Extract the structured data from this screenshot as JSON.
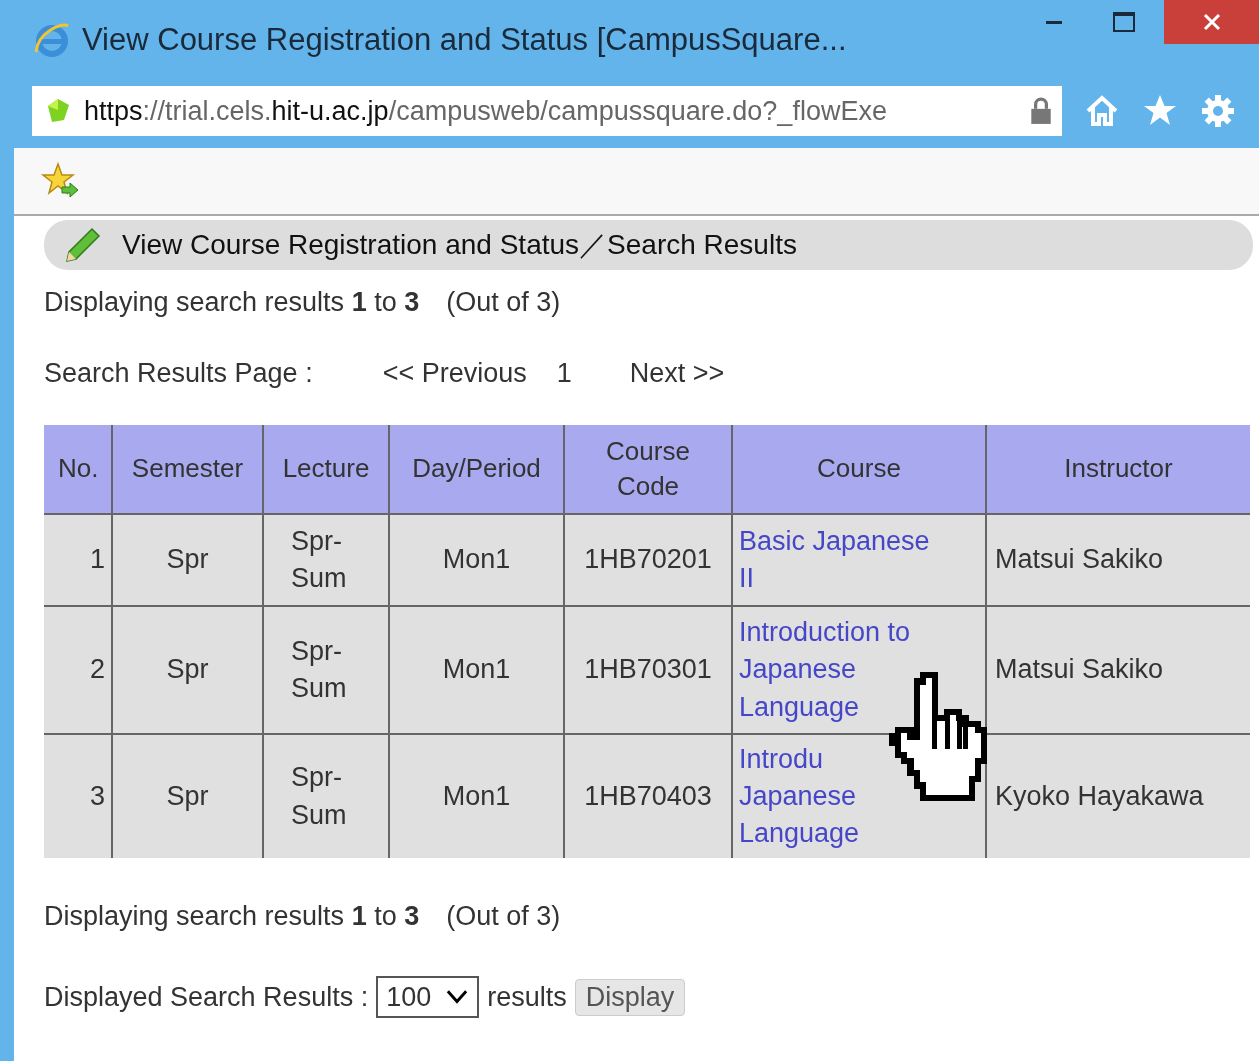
{
  "window": {
    "title": "View Course Registration and Status [CampusSquare..."
  },
  "address_bar": {
    "scheme": "https",
    "rest": "://trial.cels.",
    "host": "hit-u.ac.jp",
    "path": "/campusweb/campussquare.do?_flowExe"
  },
  "page": {
    "heading": "View Course Registration and Status／Search Results",
    "summary_top": "Displaying search results **1** to **3**　(Out of 3)",
    "pager": {
      "label": "Search Results Page :",
      "previous": "<< Previous",
      "page": "1",
      "next": "Next >>"
    },
    "table": {
      "columns": [
        "No.",
        "Semester",
        "Lecture",
        "Day/Period",
        "Course Code",
        "Course",
        "Instructor"
      ],
      "rows": [
        {
          "no": "1",
          "semester": "Spr",
          "lecture": "Spr-Sum",
          "day_period": "Mon1",
          "course_code": "1HB70201",
          "course": "Basic Japanese II",
          "instructor": "Matsui Sakiko"
        },
        {
          "no": "2",
          "semester": "Spr",
          "lecture": "Spr-Sum",
          "day_period": "Mon1",
          "course_code": "1HB70301",
          "course": "Introduction to Japanese Language",
          "instructor": "Matsui Sakiko"
        },
        {
          "no": "3",
          "semester": "Spr",
          "lecture": "Spr-Sum",
          "day_period": "Mon1",
          "course_code": "1HB70403",
          "course": "Introdu Japanese Language",
          "instructor": "Kyoko Hayakawa"
        }
      ]
    },
    "summary_bottom": "Displaying search results **1** to **3**　(Out of 3)",
    "results_per_page": {
      "label": "Displayed Search Results :",
      "value": "100",
      "suffix": "results",
      "button": "Display"
    }
  }
}
